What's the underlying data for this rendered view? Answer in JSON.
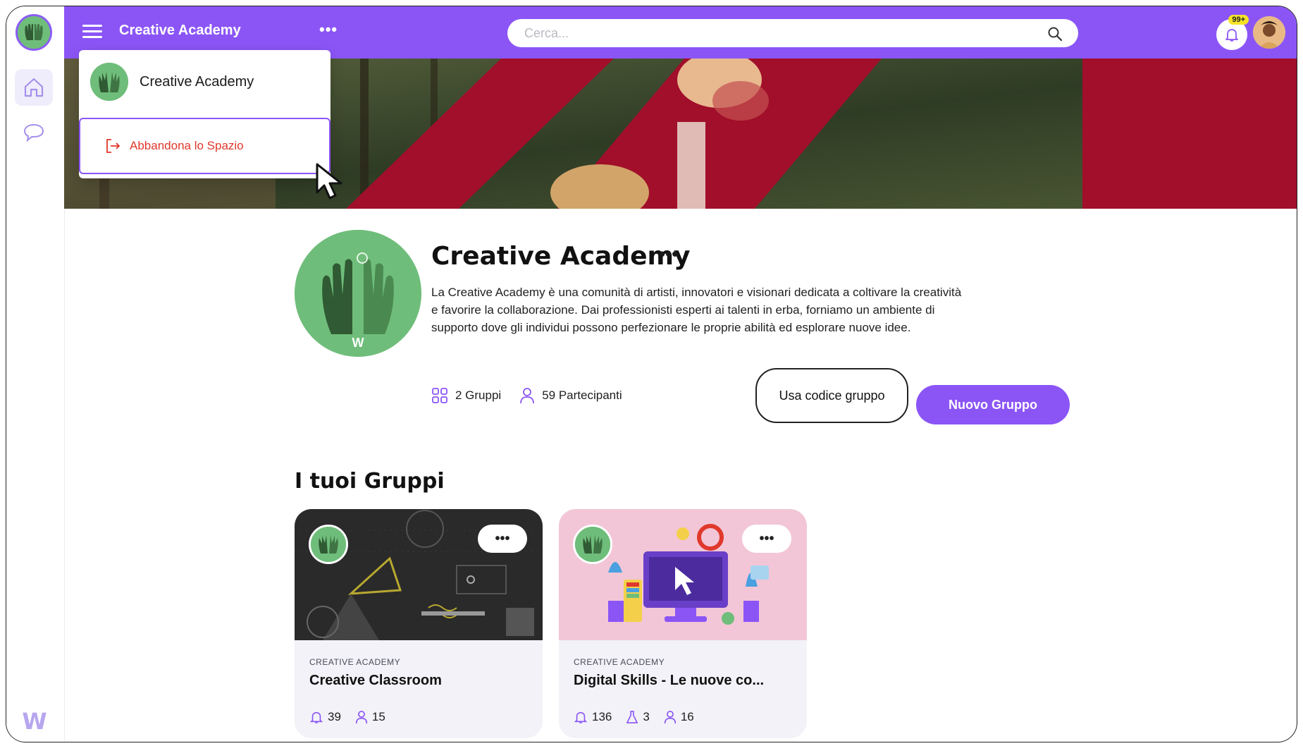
{
  "topbar": {
    "space_title": "Creative Academy",
    "more_label": "•••",
    "search_placeholder": "Cerca...",
    "notification_badge": "99+"
  },
  "dropdown": {
    "space_name": "Creative Academy",
    "leave_label": "Abbandona lo Spazio"
  },
  "profile": {
    "title": "Creative Academy",
    "more_label": "•••",
    "description": "La Creative Academy è una comunità di artisti, innovatori e visionari dedicata a coltivare la creatività e favorire la collaborazione. Dai professionisti esperti ai talenti in erba, forniamo un ambiente di supporto dove gli individui possono perfezionare le proprie abilità ed esplorare nuove idee.",
    "groups_count": "2 Gruppi",
    "participants_count": "59 Partecipanti",
    "use_code_button": "Usa codice gruppo",
    "new_group_button": "Nuovo Gruppo"
  },
  "groups_section": {
    "title": "I tuoi Gruppi",
    "cards": [
      {
        "space": "CREATIVE ACADEMY",
        "title": "Creative Classroom",
        "menu_label": "•••",
        "notifications": "39",
        "members": "15"
      },
      {
        "space": "CREATIVE ACADEMY",
        "title": "Digital Skills - Le nuove co...",
        "menu_label": "•••",
        "notifications": "136",
        "tests": "3",
        "members": "16"
      }
    ]
  },
  "sidebar": {
    "logo_letter": "W"
  },
  "colors": {
    "primary": "#8b55f6",
    "leave_red": "#e0382c",
    "badge_yellow": "#f6e327",
    "avatar_green": "#6fbd7a"
  },
  "icons": [
    "hamburger-icon",
    "search-icon",
    "bell-icon",
    "home-icon",
    "chat-icon",
    "leave-icon",
    "groups-icon",
    "user-icon",
    "flask-icon",
    "cursor-icon"
  ]
}
